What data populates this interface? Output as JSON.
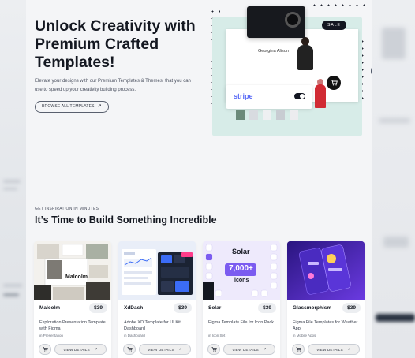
{
  "hero": {
    "title": "Unlock Creativity with Premium Crafted Templates!",
    "subtitle": "Elevate your designs with our Premium Templates & Themes, that you can use to speed up your creativity building process.",
    "browse_label": "BROWSE ALL TEMPLATES",
    "collage": {
      "sale_label": "SALE",
      "fashion_name": "Georgina Alison",
      "payment_brand": "stripe"
    }
  },
  "section": {
    "eyebrow": "GET INSPIRATION IN MINUTES",
    "title": "It’s Time to Build Something Incredible"
  },
  "cards": [
    {
      "name": "Malcolm",
      "price": "$39",
      "description": "Exploration Presentation Template with Figma",
      "category": "in Presentation",
      "thumb_text": "Malcolm.",
      "details_label": "VIEW DETAILS"
    },
    {
      "name": "XdDash",
      "price": "$39",
      "description": "Adobe XD Template for UI Kit Dashboard",
      "category": "in Dashboard",
      "details_label": "VIEW DETAILS"
    },
    {
      "name": "Solar",
      "price": "$39",
      "description": "Figma Template File for Icon Pack",
      "category": "in Icon Set",
      "thumb_title": "Solar",
      "thumb_count": "7,000+",
      "thumb_unit": "icons",
      "details_label": "VIEW DETAILS"
    },
    {
      "name": "Glassmorphism",
      "price": "$39",
      "description": "Figma File Templates for Weather App",
      "category": "in Mobile Apps",
      "details_label": "VIEW DETAILS"
    }
  ],
  "icons": {
    "cart": "cart-icon",
    "arrow": "arrow-up-right-icon",
    "shield": "shield-icon"
  },
  "colors": {
    "background": "#f4f5f7",
    "text": "#141821",
    "card": "#ffffff",
    "price_pill": "#eceef1",
    "mint": "#d7ece8",
    "solar_purple": "#7b5cf0",
    "glass_purple": "#5b2bd1"
  }
}
